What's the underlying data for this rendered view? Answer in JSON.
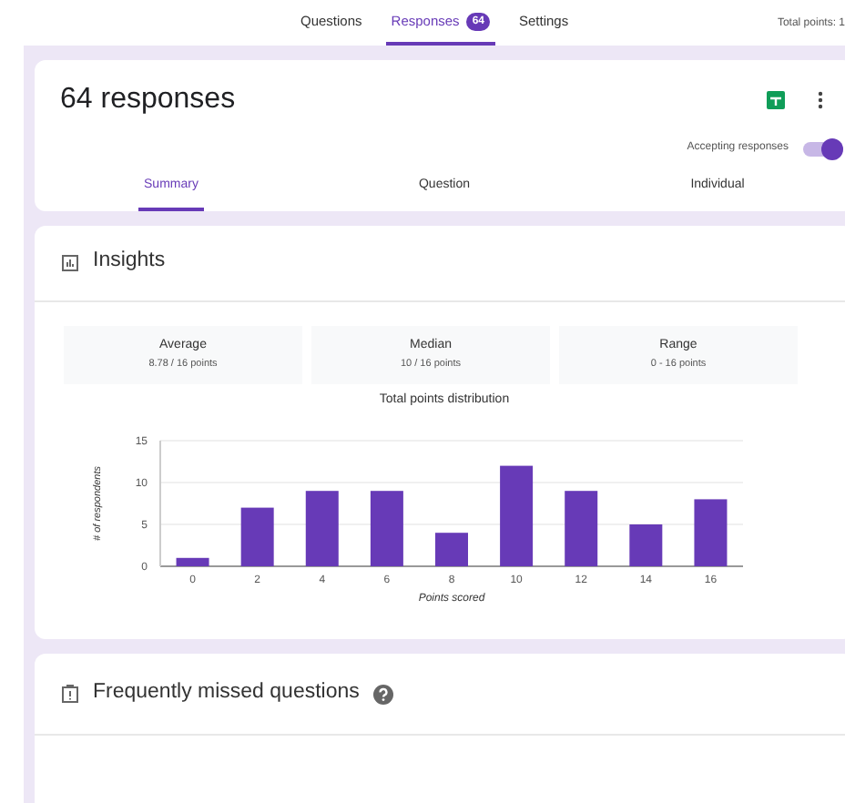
{
  "nav": {
    "tabs": [
      {
        "label": "Questions",
        "selected": false
      },
      {
        "label": "Responses",
        "selected": true,
        "badge": "64"
      },
      {
        "label": "Settings",
        "selected": false
      }
    ],
    "total_points": "Total points: 1"
  },
  "header": {
    "title": "64 responses",
    "accepting": {
      "label": "Accepting responses",
      "on": true
    },
    "tabs": [
      {
        "label": "Summary",
        "selected": true
      },
      {
        "label": "Question",
        "selected": false
      },
      {
        "label": "Individual",
        "selected": false
      }
    ]
  },
  "insights": {
    "title": "Insights",
    "stats": [
      {
        "label": "Average",
        "value": "8.78 / 16 points"
      },
      {
        "label": "Median",
        "value": "10 / 16 points"
      },
      {
        "label": "Range",
        "value": "0 - 16 points"
      }
    ],
    "chart_data": {
      "type": "bar",
      "title": "Total points distribution",
      "xlabel": "Points scored",
      "ylabel": "# of respondents",
      "categories": [
        "0",
        "2",
        "4",
        "6",
        "8",
        "10",
        "12",
        "14",
        "16"
      ],
      "series": [
        {
          "color": "#673ab7",
          "values": [
            1,
            7,
            9,
            9,
            4,
            12,
            9,
            5,
            8
          ]
        }
      ],
      "ylim": [
        0,
        15
      ],
      "yticks": [
        0,
        5,
        10,
        15
      ]
    }
  },
  "missed": {
    "title": "Frequently missed questions"
  }
}
